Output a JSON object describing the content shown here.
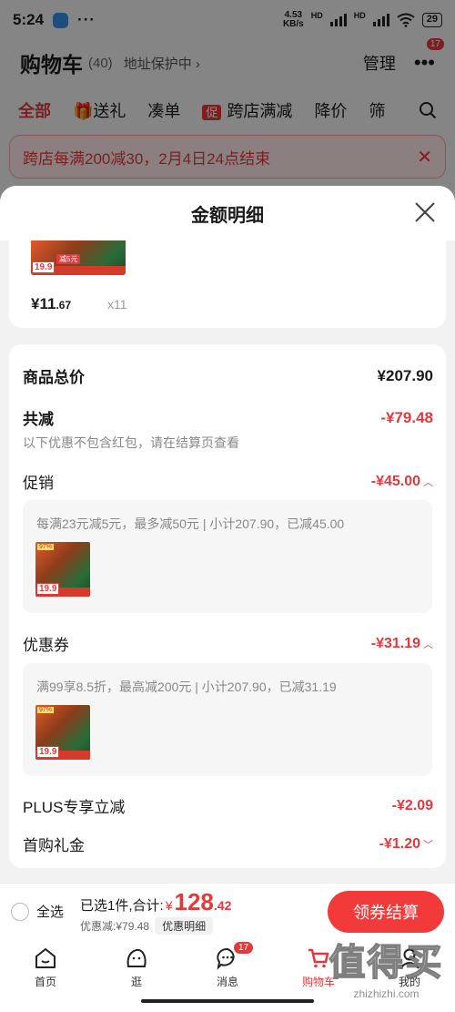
{
  "status_bar": {
    "time": "5:24",
    "more": "···",
    "net_speed": "4.53",
    "net_unit": "KB/s",
    "hd1": "HD",
    "hd2": "HD",
    "battery": "29"
  },
  "header": {
    "title": "购物车",
    "count": "(40)",
    "address_protect": "地址保护中 ›",
    "manage": "管理",
    "more": "•••",
    "badge": "17"
  },
  "tabs": {
    "all": "全部",
    "gift": "送礼",
    "combine": "凑单",
    "cu_badge": "促",
    "cross_store": "跨店满减",
    "price_drop": "降价",
    "filter": "筛"
  },
  "promo_banner": {
    "text": "跨店每满200减30，2月4日24点结束",
    "close": "✕"
  },
  "sheet": {
    "title": "金额明细",
    "top_item": {
      "price_int": "¥11",
      "price_dec": ".67",
      "qty": "x11"
    },
    "product_tags": {
      "price_tag": "19.9",
      "discount_tag": "减5元"
    },
    "total_label": "商品总价",
    "total_value": "¥207.90",
    "reduce_label": "共减",
    "reduce_value": "-¥79.48",
    "reduce_note": "以下优惠不包含红包，请在结算页查看",
    "promo_label": "促销",
    "promo_value": "-¥45.00",
    "promo_desc": "每满23元减5元，最多减50元 | 小计207.90，已减45.00",
    "coupon_label": "优惠券",
    "coupon_value": "-¥31.19",
    "coupon_desc": "满99享8.5折，最高减200元 | 小计207.90，已减31.19",
    "plus_label": "PLUS专享立减",
    "plus_value": "-¥2.09",
    "first_label": "首购礼金",
    "first_value": "-¥1.20"
  },
  "checkout": {
    "select_all": "全选",
    "selected": "已选1件,合计:",
    "currency": "¥",
    "total_int": "128",
    "total_dec": ".42",
    "discount": "优惠减:¥79.48",
    "detail_chip": "优惠明细",
    "button": "领券结算"
  },
  "tabbar": [
    {
      "label": "首页",
      "icon": "home-icon"
    },
    {
      "label": "逛",
      "icon": "browse-icon"
    },
    {
      "label": "消息",
      "icon": "message-icon",
      "badge": "17"
    },
    {
      "label": "购物车",
      "icon": "cart-icon"
    },
    {
      "label": "我的",
      "icon": "profile-icon"
    }
  ],
  "watermark": {
    "big": "值得买",
    "small": "zhizhizhi.com"
  },
  "colors": {
    "accent": "#e4393c",
    "button": "#f23a3a"
  }
}
